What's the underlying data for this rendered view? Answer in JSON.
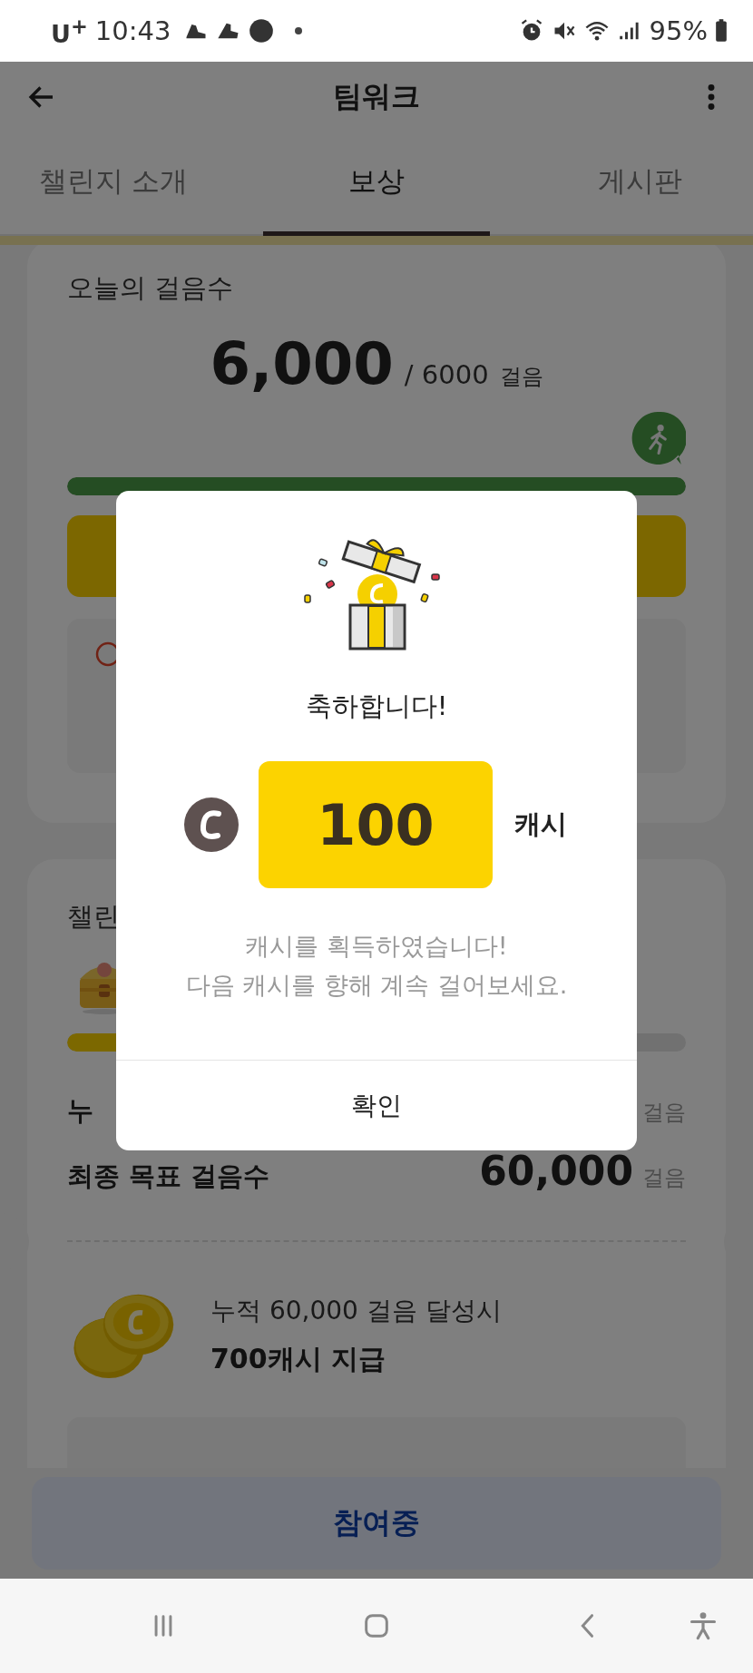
{
  "status_bar": {
    "carrier": "U$^{+}$",
    "time": "10:43",
    "battery": "95%"
  },
  "app_bar": {
    "title": "팀워크"
  },
  "tabs": [
    {
      "label": "챌린지 소개",
      "selected": false
    },
    {
      "label": "보상",
      "selected": true
    },
    {
      "label": "게시판",
      "selected": false
    }
  ],
  "today_card": {
    "title": "오늘의 걸음수",
    "steps": "6,000",
    "goal": "/ 6000",
    "unit": "걸음",
    "progress": {
      "level": 1
    }
  },
  "challenge_card": {
    "title": "챌린",
    "progress": {
      "level": 0.1
    },
    "rows": [
      {
        "label": "누",
        "unit": "걸음"
      },
      {
        "label": "최종 목표 걸음수",
        "value": "60,000",
        "unit": "걸음"
      }
    ],
    "reward": {
      "condition": "누적 60,000 걸음 달성시",
      "amount": "700캐시 지급"
    }
  },
  "bottom_button": {
    "label": "참여중"
  },
  "dialog": {
    "title": "축하합니다!",
    "amount": "100",
    "unit": "캐시",
    "message": [
      "캐시를 획득하였습니다!",
      "다음 캐시를 향해 계속 걸어보세요."
    ],
    "confirm": "확인"
  }
}
